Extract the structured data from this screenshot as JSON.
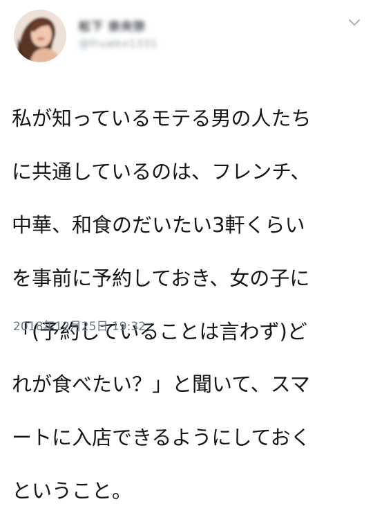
{
  "tweet": {
    "author": {
      "display_name": "松下 奈央弥",
      "handle": "@fruwkx1331"
    },
    "text_lines": [
      "私が知っているモテる男の人たち",
      "に共通しているのは、フレンチ、",
      "中華、和食のだいたい3軒くらい",
      "を事前に予約しておき、女の子に",
      "「(予約していることは言わず)ど",
      "れが食べたい？」と聞いて、スマ",
      "ートに入店できるようにしておく",
      "ということ。"
    ],
    "timestamp": "2018年12月25日 19:32"
  },
  "icons": {
    "caret": "chevron-down-icon",
    "avatar": "avatar"
  },
  "colors": {
    "text": "#14171a",
    "secondary": "#657786",
    "caret": "#aab8c2"
  }
}
